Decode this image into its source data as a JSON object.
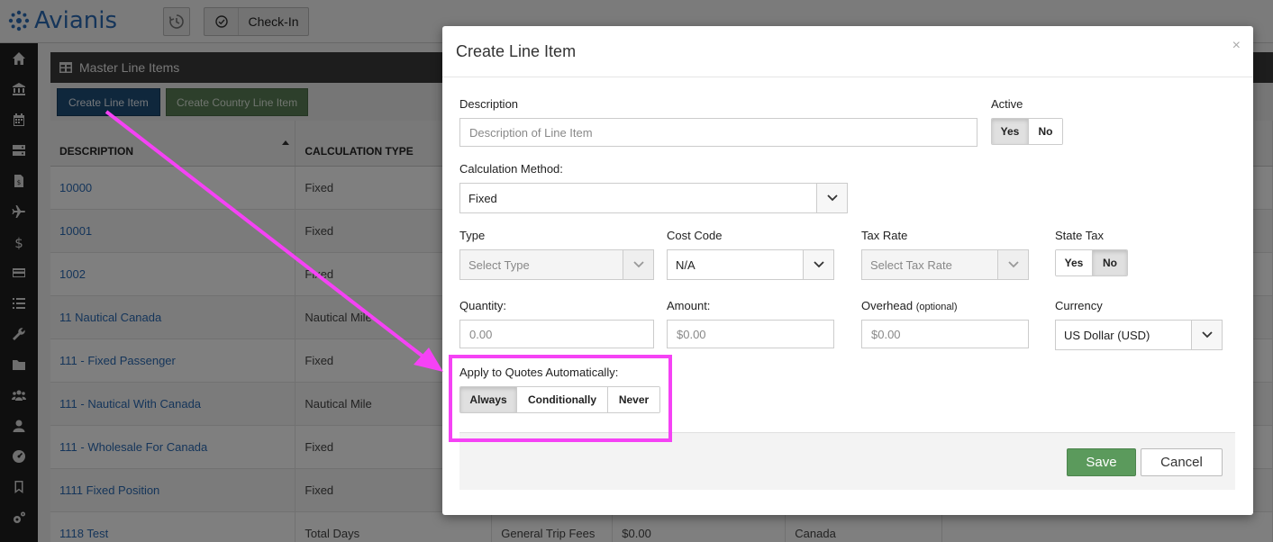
{
  "app": {
    "logo_text": "Avianis",
    "checkin_label": "Check-In"
  },
  "sidebar": {
    "items": [
      "home-icon",
      "bank-icon",
      "calendar-icon",
      "server-icon",
      "invoice-icon",
      "plane-icon",
      "dollar-icon",
      "credit-card-icon",
      "list-icon",
      "wrench-icon",
      "folder-icon",
      "people-icon",
      "user-icon",
      "dashboard-icon",
      "bookmark-icon",
      "settings-icon",
      "globe-icon"
    ]
  },
  "panel": {
    "title": "Master Line Items",
    "create_label": "Create Line Item",
    "create_country_label": "Create Country Line Item",
    "columns": [
      "DESCRIPTION",
      "CALCULATION TYPE"
    ],
    "rows": [
      {
        "description": "10000",
        "calc": "Fixed"
      },
      {
        "description": "10001",
        "calc": "Fixed"
      },
      {
        "description": "1002",
        "calc": "Fixed"
      },
      {
        "description": "11 Nautical Canada",
        "calc": "Nautical Mile"
      },
      {
        "description": "111 - Fixed Passenger",
        "calc": "Fixed"
      },
      {
        "description": "111 - Nautical With Canada",
        "calc": "Nautical Mile"
      },
      {
        "description": "111 - Wholesale For Canada",
        "calc": "Fixed"
      },
      {
        "description": "1111 Fixed Position",
        "calc": "Fixed"
      },
      {
        "description": "1118 Test",
        "calc": "Total Days"
      }
    ],
    "last_row_extra": {
      "category": "General Trip Fees",
      "amount": "$0.00",
      "country": "Canada"
    }
  },
  "modal": {
    "title": "Create Line Item",
    "close": "×",
    "description": {
      "label": "Description",
      "placeholder": "Description of Line Item"
    },
    "active": {
      "label": "Active",
      "yes": "Yes",
      "no": "No"
    },
    "calc_method": {
      "label": "Calculation Method:",
      "value": "Fixed"
    },
    "type": {
      "label": "Type",
      "placeholder": "Select Type"
    },
    "cost_code": {
      "label": "Cost Code",
      "value": "N/A"
    },
    "tax_rate": {
      "label": "Tax Rate",
      "placeholder": "Select Tax Rate"
    },
    "state_tax": {
      "label": "State Tax",
      "yes": "Yes",
      "no": "No"
    },
    "quantity": {
      "label": "Quantity:",
      "placeholder": "0.00"
    },
    "amount": {
      "label": "Amount:",
      "placeholder": "$0.00"
    },
    "overhead": {
      "label": "Overhead",
      "optional": "(optional)",
      "placeholder": "$0.00"
    },
    "currency": {
      "label": "Currency",
      "value": "US Dollar (USD)"
    },
    "apply_quotes": {
      "label": "Apply to Quotes Automatically:",
      "always": "Always",
      "conditionally": "Conditionally",
      "never": "Never"
    },
    "save_label": "Save",
    "cancel_label": "Cancel"
  },
  "colors": {
    "brand": "#2a6ab5",
    "save": "#5b9a5c",
    "annotation": "#f542f5"
  }
}
